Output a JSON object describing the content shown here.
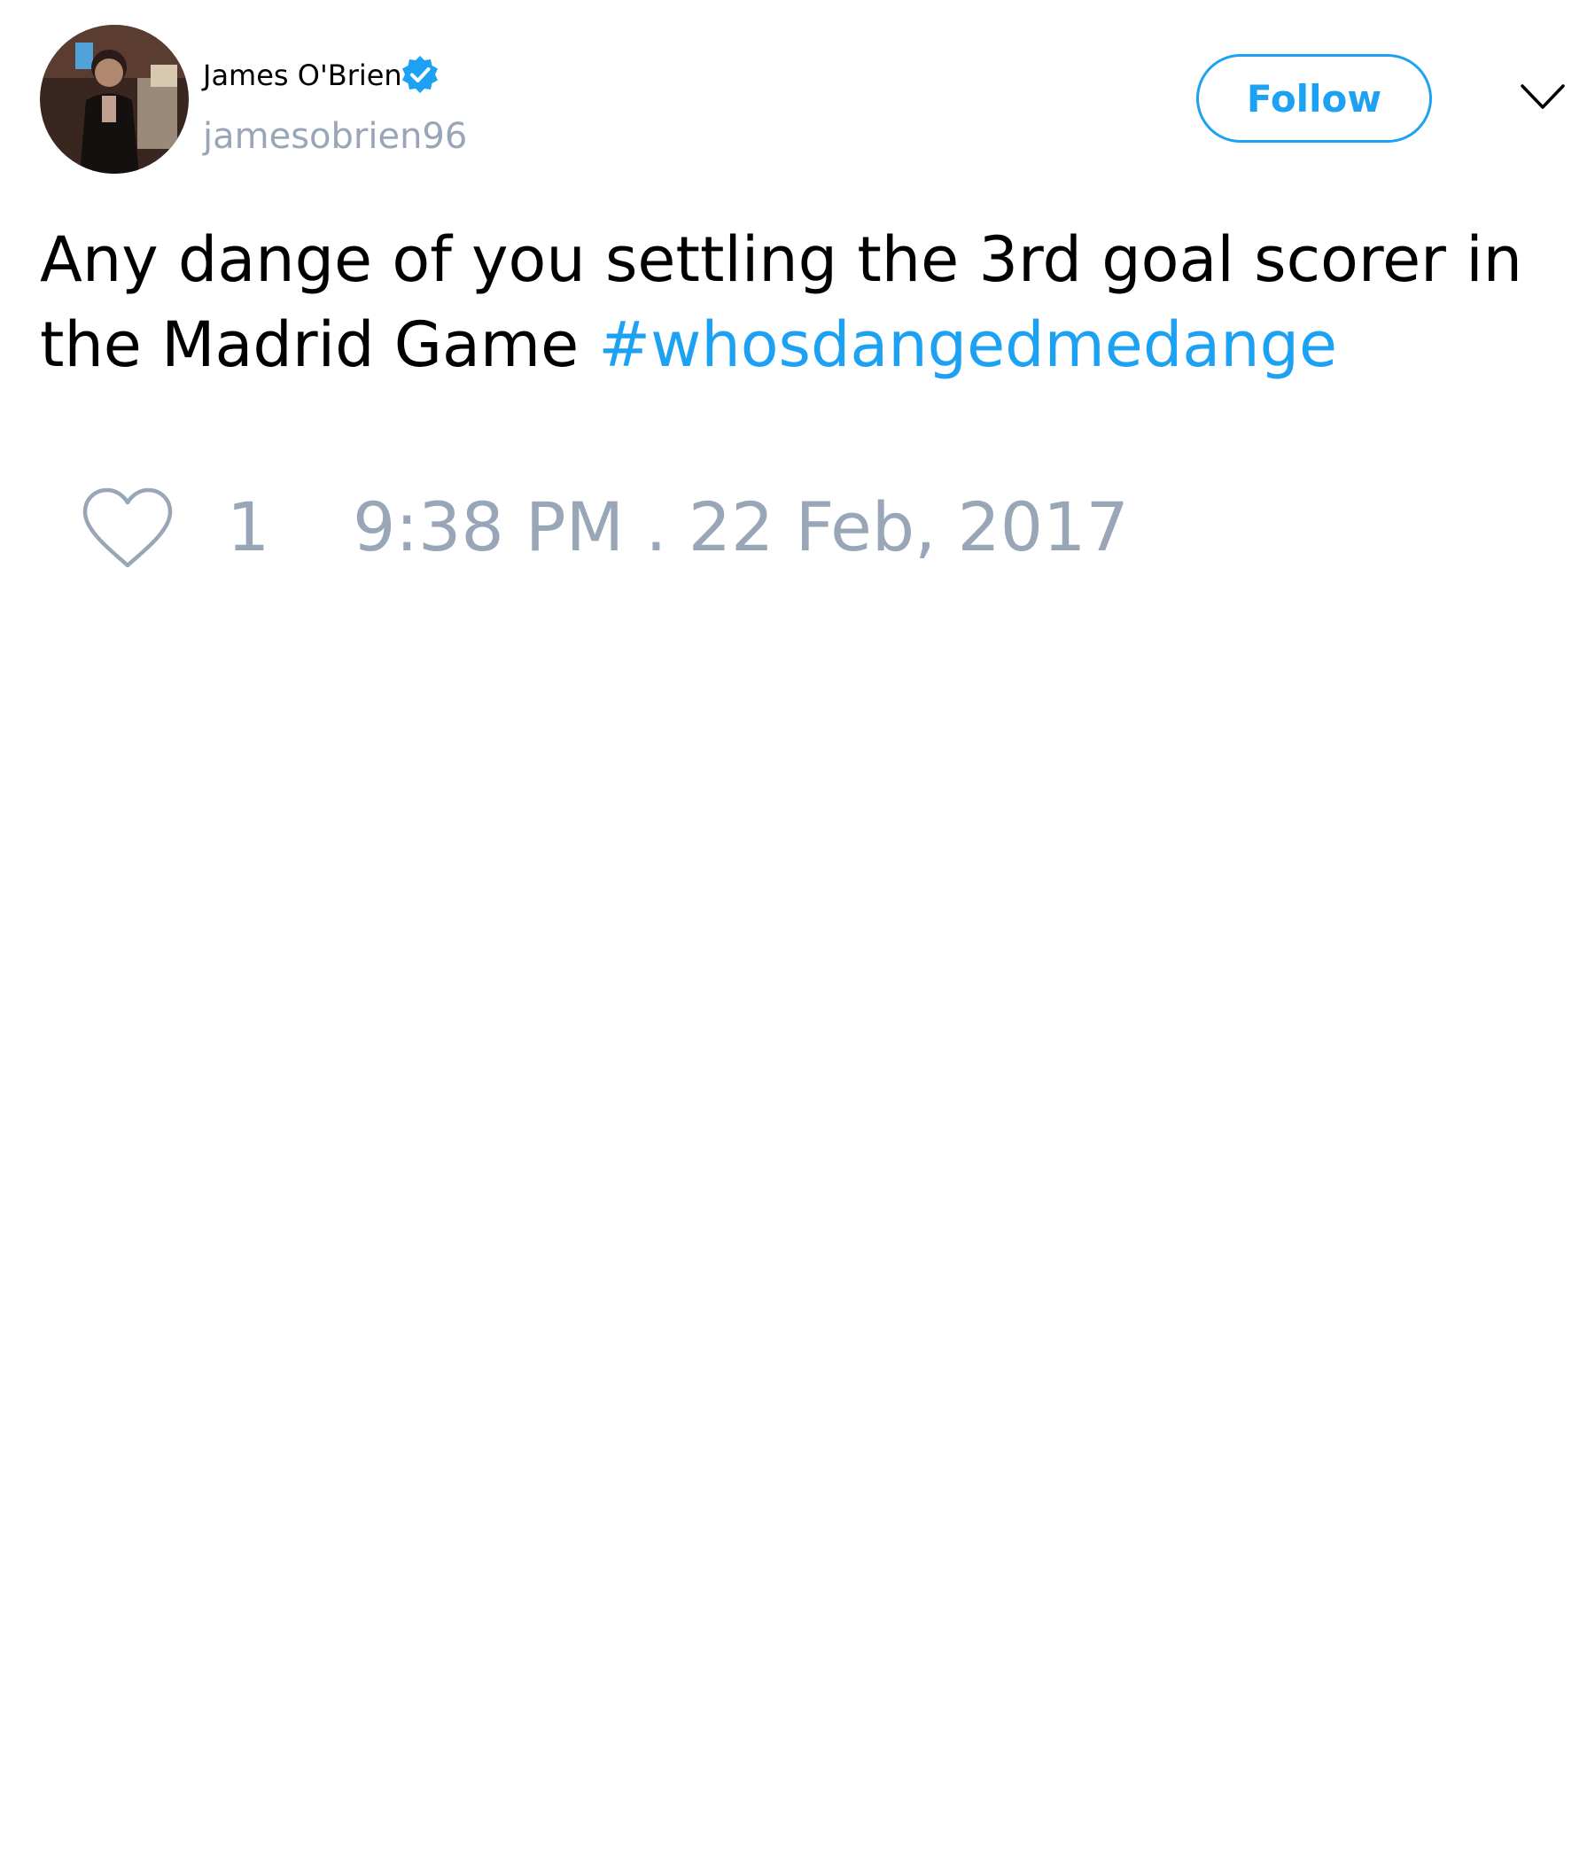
{
  "author": {
    "display_name": "James O'Brien",
    "handle": "jamesobrien96",
    "verified": true,
    "avatar": "profile-photo"
  },
  "header": {
    "follow_label": "Follow",
    "menu_icon": "chevron-down-icon"
  },
  "tweet": {
    "text": "Any dange of you settling the 3rd goal scorer in the Madrid Game ",
    "hashtag": "#whosdangedmedange"
  },
  "footer": {
    "like_icon": "heart-icon",
    "like_count": "1",
    "timestamp": "9:38 PM . 22 Feb, 2017"
  },
  "colors": {
    "accent": "#1da1f2",
    "muted": "#98a6b8",
    "text": "#000000",
    "background": "#ffffff"
  }
}
